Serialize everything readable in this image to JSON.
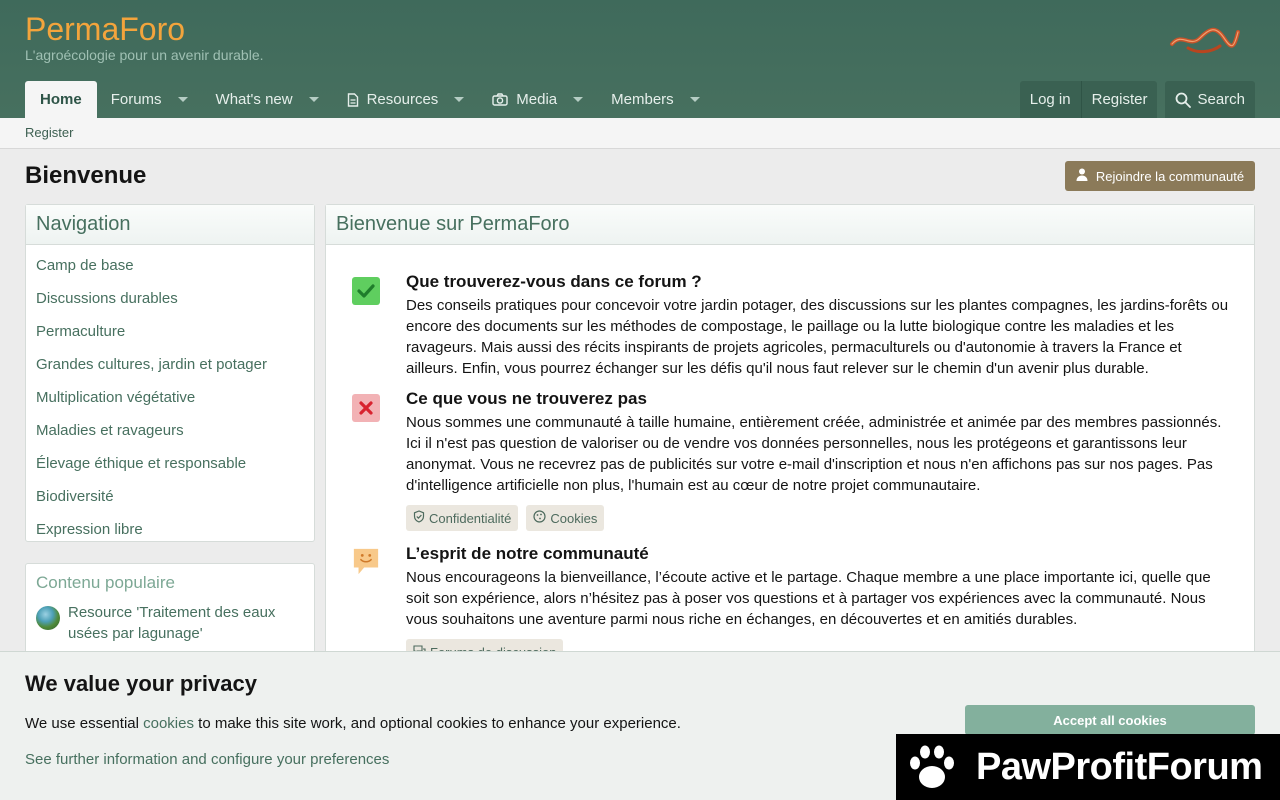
{
  "brand": {
    "title": "PermaForo",
    "subtitle": "L'agroécologie pour un avenir durable."
  },
  "nav": {
    "home": "Home",
    "forums": "Forums",
    "whats_new": "What's new",
    "resources": "Resources",
    "media": "Media",
    "members": "Members",
    "login": "Log in",
    "register": "Register",
    "search": "Search"
  },
  "subnav": {
    "register": "Register"
  },
  "page": {
    "title": "Bienvenue",
    "join_button": "Rejoindre la communauté"
  },
  "sidebar": {
    "nav_title": "Navigation",
    "items": [
      "Camp de base",
      "Discussions durables",
      "Permaculture",
      "Grandes cultures, jardin et potager",
      "Multiplication végétative",
      "Maladies et ravageurs",
      "Élevage éthique et responsable",
      "Biodiversité",
      "Expression libre"
    ],
    "popular_title": "Contenu populaire",
    "popular_item": "Resource 'Traitement des eaux usées par lagunage'"
  },
  "main": {
    "title": "Bienvenue sur PermaForo",
    "sections": [
      {
        "heading": "Que trouverez-vous dans ce forum ?",
        "text": "Des conseils pratiques pour concevoir votre jardin potager, des discussions sur les plantes compagnes, les jardins-forêts ou encore des documents sur les méthodes de compostage, le paillage ou la lutte biologique contre les maladies et les ravageurs. Mais aussi des récits inspirants de projets agricoles, permaculturels ou d'autonomie à travers la France et ailleurs. Enfin, vous pourrez échanger sur les défis qu'il nous faut relever sur le chemin d'un avenir plus durable."
      },
      {
        "heading": "Ce que vous ne trouverez pas",
        "text": "Nous sommes une communauté à taille humaine, entièrement créée, administrée et animée par des membres passionnés. Ici il n'est pas question de valoriser ou de vendre vos données personnelles, nous les protégeons et garantissons leur anonymat. Vous ne recevrez pas de publicités sur votre e-mail d'inscription et nous n'en affichons pas sur nos pages. Pas d'intelligence artificielle non plus, l'humain est au cœur de notre projet communautaire.",
        "tags": [
          "Confidentialité",
          "Cookies"
        ]
      },
      {
        "heading": "L’esprit de notre communauté",
        "text": "Nous encourageons la bienveillance, l’écoute active et le partage. Chaque membre a une place importante ici, quelle que soit son expérience, alors n’hésitez pas à poser vos questions et à partager vos expériences avec la communauté. Nous vous souhaitons une aventure parmi nous riche en échanges, en découvertes et en amitiés durables.",
        "tags": [
          "Forums de discussion"
        ]
      }
    ]
  },
  "cookie": {
    "title": "We value your privacy",
    "line1_before": "We use essential ",
    "line1_link": "cookies",
    "line1_after": " to make this site work, and optional cookies to enhance your experience.",
    "line2": "See further information and configure your preferences",
    "accept": "Accept all cookies"
  },
  "watermark": {
    "text": "PawProfitForum"
  },
  "colors": {
    "header": "#47705f",
    "brand": "#f3a43c",
    "link": "#47705f",
    "join": "#8b7a59",
    "accept": "#83b09d"
  }
}
